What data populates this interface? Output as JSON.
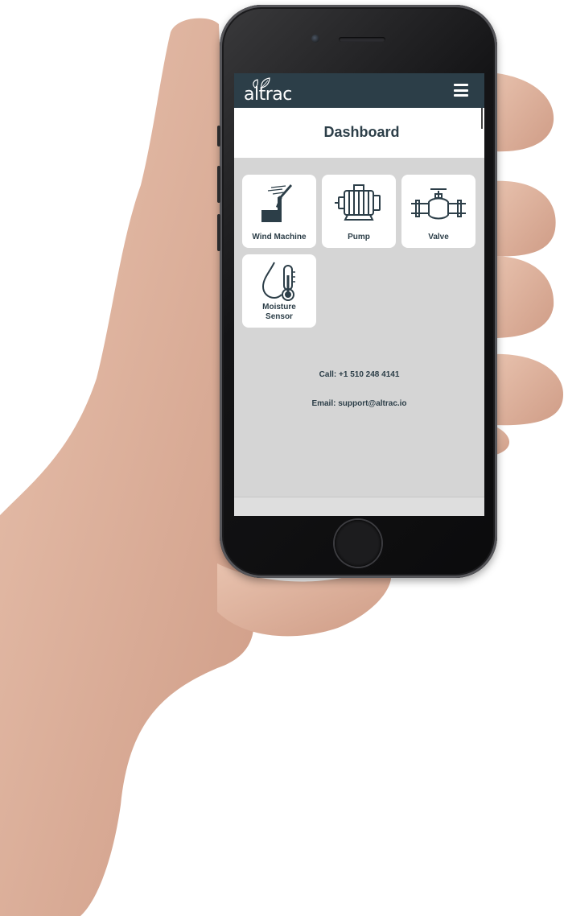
{
  "app": {
    "logo_text": "altrac",
    "page_title": "Dashboard"
  },
  "tiles": [
    {
      "label": "Wind Machine",
      "icon": "wind-machine-icon"
    },
    {
      "label": "Pump",
      "icon": "pump-icon"
    },
    {
      "label": "Valve",
      "icon": "valve-icon"
    },
    {
      "label": "Moisture Sensor",
      "icon": "moisture-sensor-icon"
    }
  ],
  "contact": {
    "call": "Call: +1 510 248 4141",
    "email": "Email: support@altrac.io"
  },
  "colors": {
    "header_bg": "#2c3e48",
    "body_bg": "#d5d5d5",
    "tile_bg": "#ffffff",
    "text": "#2c3e48"
  }
}
